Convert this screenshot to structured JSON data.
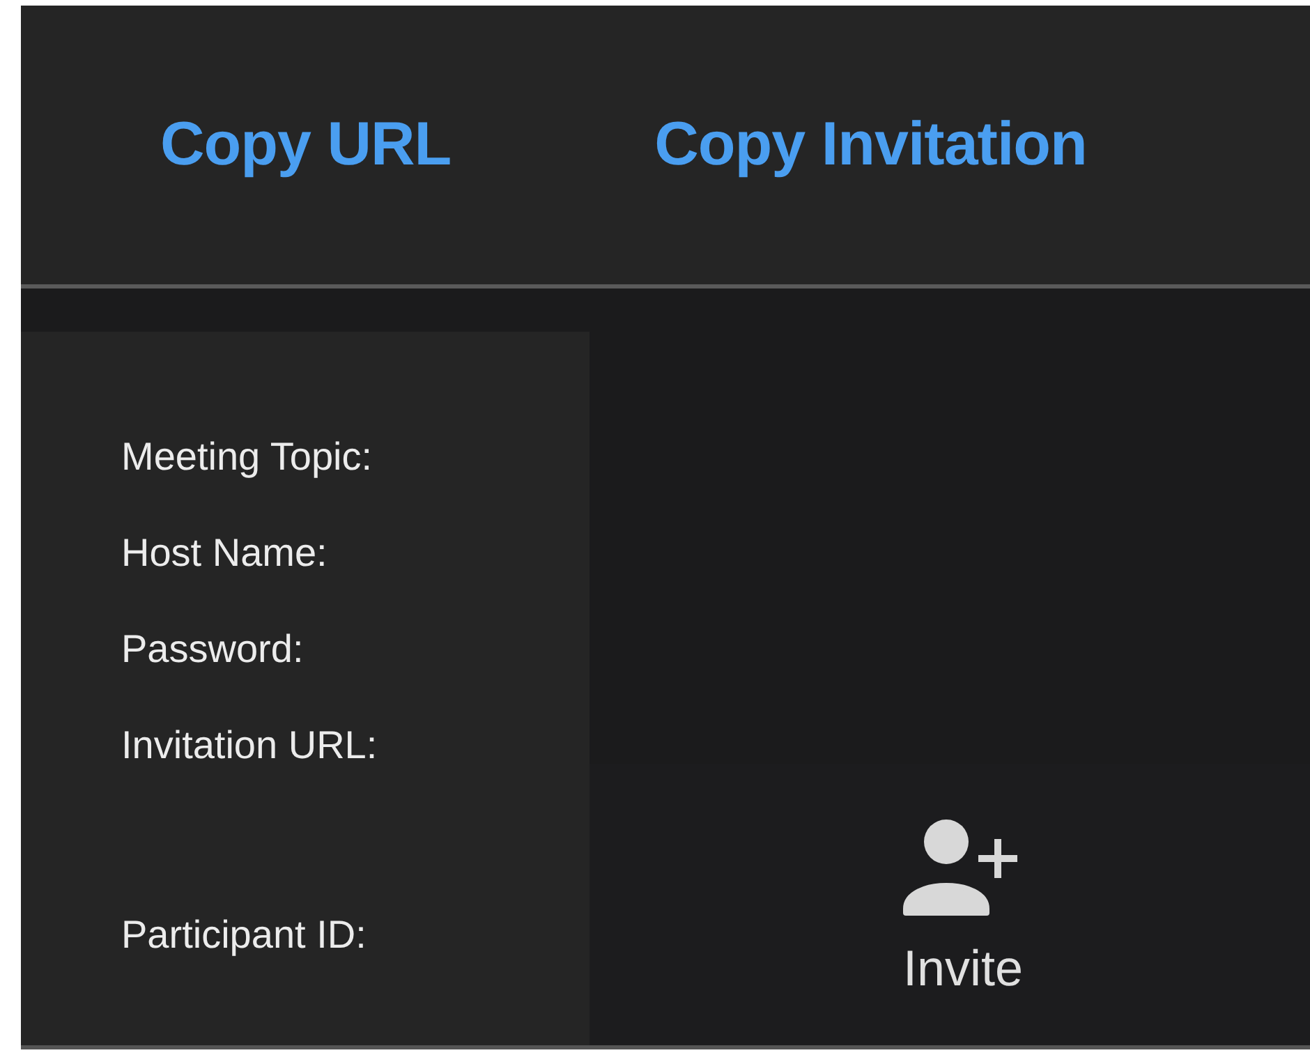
{
  "toolbar": {
    "buttons": [
      {
        "label": "Copy URL"
      },
      {
        "label": "Copy Invitation"
      }
    ]
  },
  "info_panel": {
    "labels": [
      {
        "text": "Meeting Topic:",
        "kind": "field"
      },
      {
        "text": "Host Name:",
        "kind": "field"
      },
      {
        "text": "Password:",
        "kind": "field"
      },
      {
        "text": "Invitation URL:",
        "kind": "field"
      },
      {
        "text": "Participant ID:",
        "kind": "spaced"
      }
    ]
  },
  "controls": [
    {
      "label": "Invite",
      "kind": "invite"
    }
  ]
}
